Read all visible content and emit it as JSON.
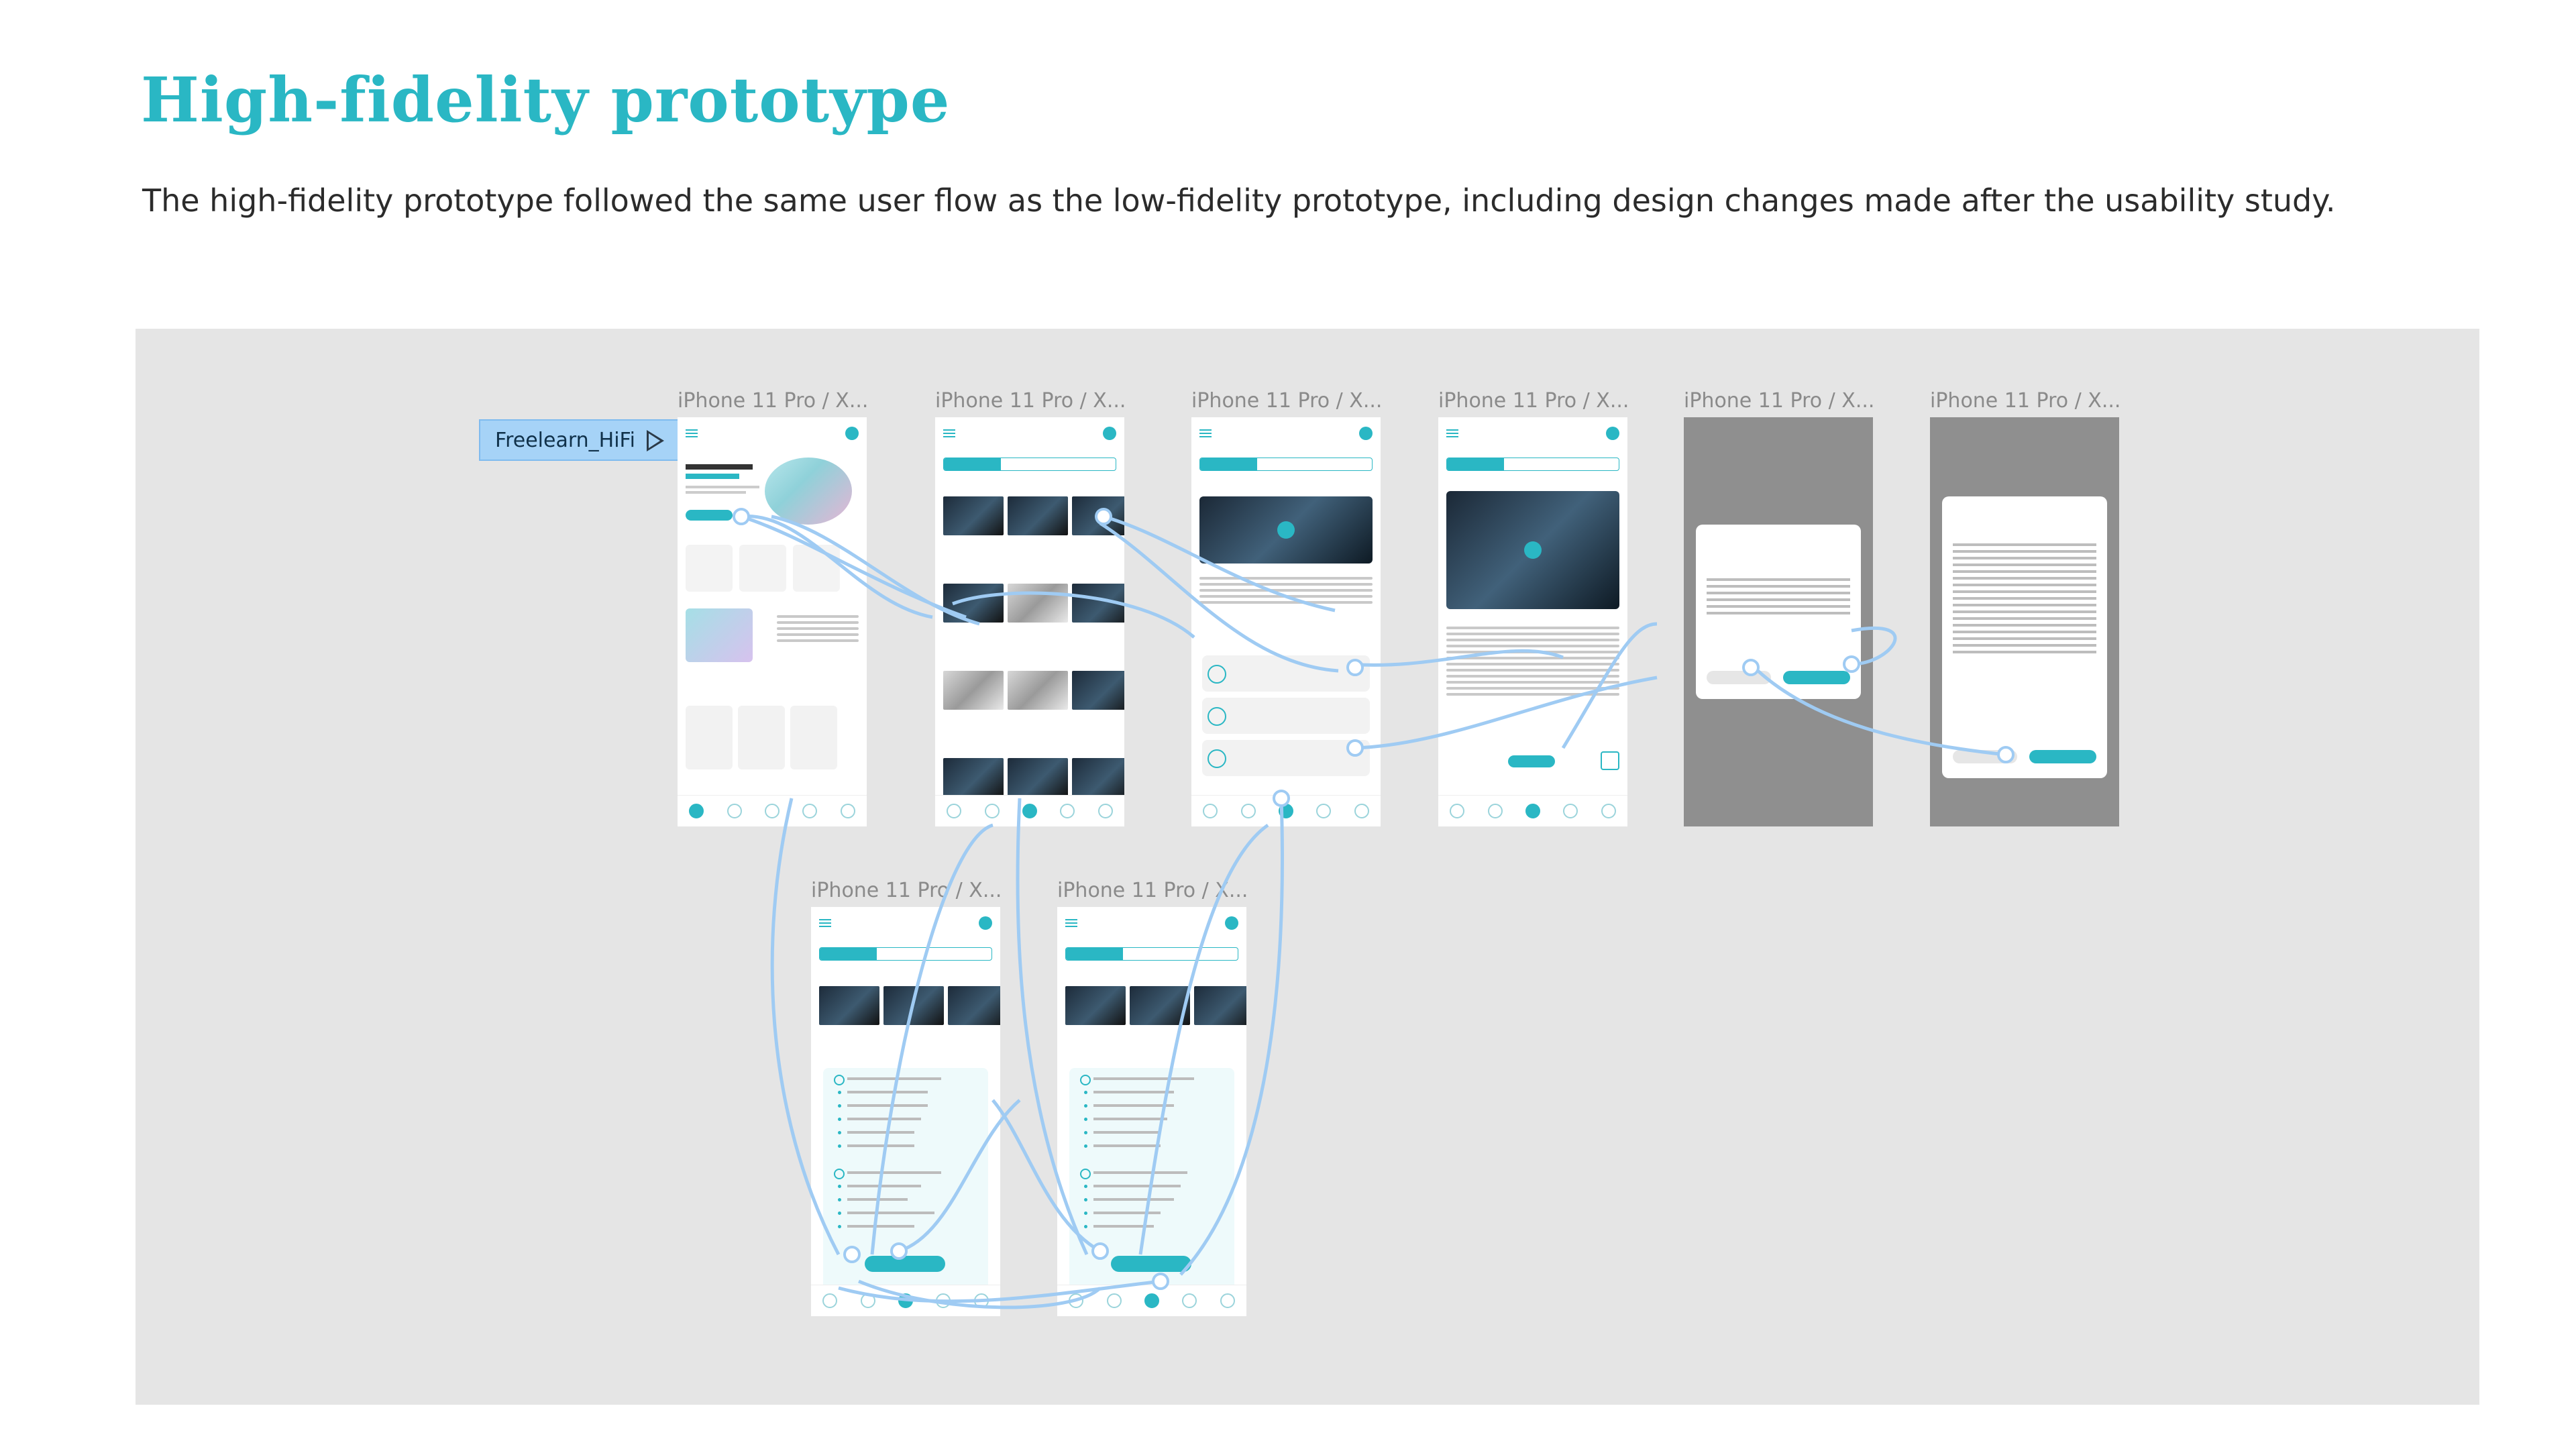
{
  "heading": "High-fidelity prototype",
  "intro": "The high-fidelity prototype followed the same user flow as the low-fidelity prototype, including design changes made after the usability study.",
  "flow": {
    "name": "Freelearn_HiFi",
    "play_icon": "play-icon"
  },
  "frame_label": "iPhone 11 Pro / X...",
  "colors": {
    "accent": "#2ab7c4",
    "link": "#9fcbf3",
    "canvas": "#e5e5e5"
  }
}
